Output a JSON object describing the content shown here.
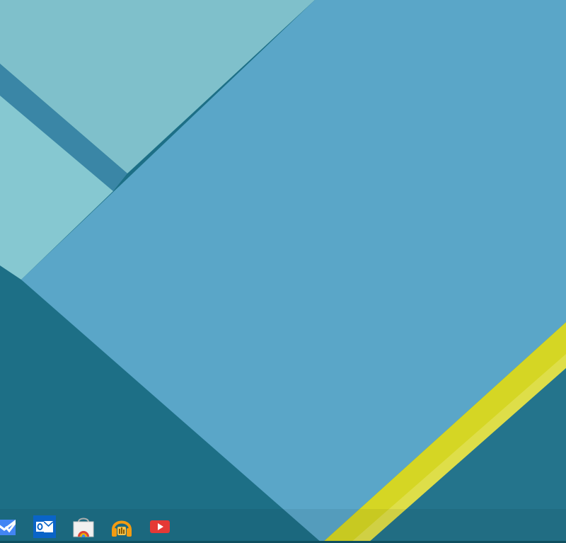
{
  "desktop": {
    "wallpaper_colors": {
      "deep_teal": "#1d6f86",
      "light_aqua": "#7fc0cb",
      "mid_aqua": "#86c8d1",
      "blue_panel": "#5aa6c8",
      "dark_stripe": "#3a86a6",
      "yellow_stripe": "#d5d624",
      "yellow_light": "#dede49"
    }
  },
  "shelf": {
    "apps": [
      {
        "icon": "inbox-icon",
        "color": "#4285f4"
      },
      {
        "icon": "outlook-icon",
        "color": "#0a64c8"
      },
      {
        "icon": "web-store-icon",
        "color": "#e8e8e8"
      },
      {
        "icon": "music-headphones-icon",
        "color": "#f39c12"
      },
      {
        "icon": "youtube-icon",
        "color": "#e53935"
      }
    ]
  }
}
